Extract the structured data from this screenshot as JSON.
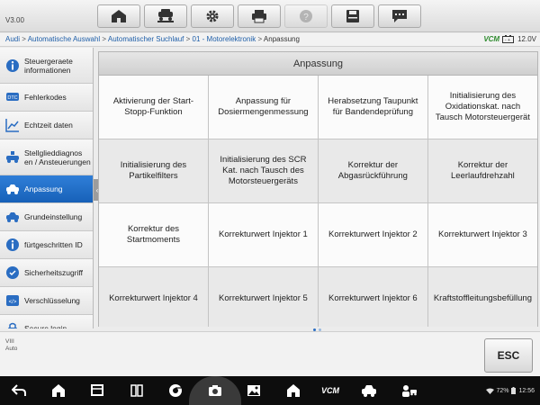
{
  "app": {
    "version": "V3.00"
  },
  "toolbar": {
    "buttons": [
      {
        "name": "home-button",
        "icon": "home-icon"
      },
      {
        "name": "vehicle-swap-button",
        "icon": "car-swap-icon"
      },
      {
        "name": "settings-button",
        "icon": "gear-icon"
      },
      {
        "name": "print-button",
        "icon": "printer-icon"
      },
      {
        "name": "help-button",
        "icon": "help-icon",
        "disabled": true
      },
      {
        "name": "save-button",
        "icon": "save-icon"
      },
      {
        "name": "data-logging-button",
        "icon": "chat-icon"
      }
    ]
  },
  "breadcrumb": {
    "items": [
      "Audi",
      "Automatische Auswahl",
      "Automatischer Suchlauf",
      "01 - Motorelektronik"
    ],
    "current": "Anpassung",
    "separator": " > "
  },
  "status": {
    "vcm": "VCM",
    "voltage": "12.0V"
  },
  "sidebar": {
    "items": [
      {
        "label": "Steuergeraete informationen",
        "icon": "info-icon"
      },
      {
        "label": "Fehlerkodes",
        "icon": "dtc-icon"
      },
      {
        "label": "Echtzeit daten",
        "icon": "chart-line-icon"
      },
      {
        "label": "Stellglieddiagnos en / Ansteuerungen",
        "icon": "actuator-icon"
      },
      {
        "label": "Anpassung",
        "icon": "car-adapt-icon",
        "active": true
      },
      {
        "label": "Grundeinstellung",
        "icon": "car-basic-icon"
      },
      {
        "label": "fürtgeschritten ID",
        "icon": "info-icon"
      },
      {
        "label": "Sicherheitszugriff",
        "icon": "security-icon"
      },
      {
        "label": "Verschlüsselung",
        "icon": "encoding-icon"
      },
      {
        "label": "Secure login",
        "icon": "login-icon"
      }
    ]
  },
  "main": {
    "title": "Anpassung",
    "functions": [
      "Aktivierung der Start-Stopp-Funktion",
      "Anpassung für Dosiermengenmessung",
      "Herabsetzung Taupunkt für Bandendeprüfung",
      "Initialisierung des Oxidationskat. nach Tausch Motorsteuergerät",
      "Initialisierung des Partikelfilters",
      "Initialisierung des SCR Kat. nach Tausch des Motorsteuergeräts",
      "Korrektur der Abgasrückführung",
      "Korrektur der Leerlaufdrehzahl",
      "Korrektur des Startmoments",
      "Korrekturwert Injektor 1",
      "Korrekturwert Injektor 2",
      "Korrekturwert Injektor 3",
      "Korrekturwert Injektor 4",
      "Korrekturwert Injektor 5",
      "Korrekturwert Injektor 6",
      "Kraftstoffleitungsbefüllung"
    ]
  },
  "vehicle_info": {
    "line1": "VIII",
    "line2": "Auto"
  },
  "esc_label": "ESC",
  "system": {
    "battery": "72%",
    "time": "12:56",
    "vcm_nav": "VCM"
  },
  "colors": {
    "accent": "#1761b8",
    "tile": "#fbfbfb",
    "tile_alt": "#e9e9e9"
  }
}
